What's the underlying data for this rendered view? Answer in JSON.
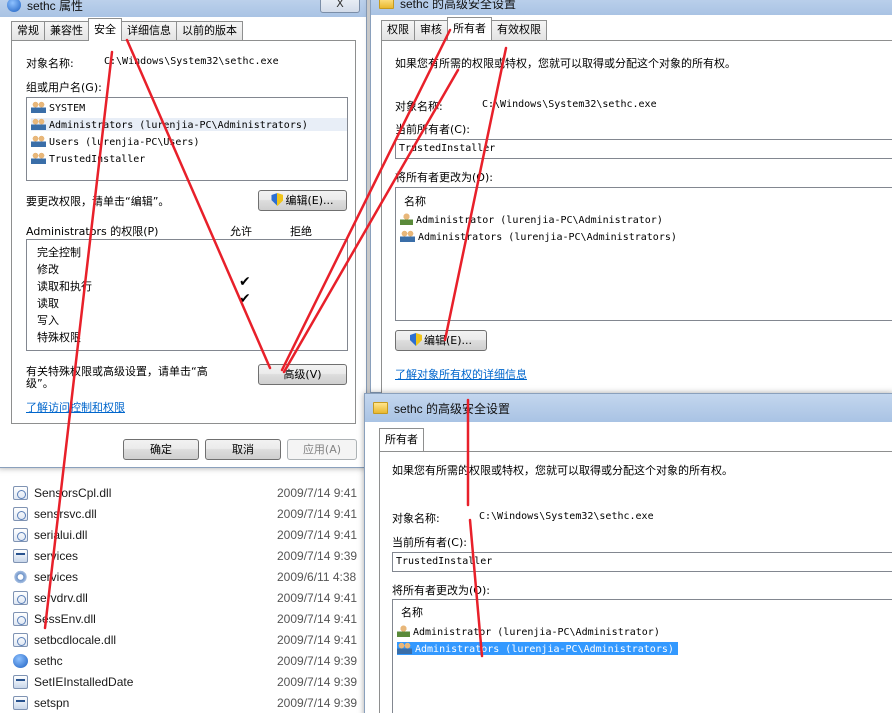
{
  "explorer": {
    "files": [
      {
        "name": "SensorsCpl.dll",
        "date": "2009/7/14 9:41",
        "icon": "dll"
      },
      {
        "name": "sensrsvc.dll",
        "date": "2009/7/14 9:41",
        "icon": "dll"
      },
      {
        "name": "serialui.dll",
        "date": "2009/7/14 9:41",
        "icon": "dll"
      },
      {
        "name": "services",
        "date": "2009/7/14 9:39",
        "icon": "app"
      },
      {
        "name": "services",
        "date": "2009/6/11 4:38",
        "icon": "gear"
      },
      {
        "name": "servdrv.dll",
        "date": "2009/7/14 9:41",
        "icon": "dll"
      },
      {
        "name": "SessEnv.dll",
        "date": "2009/7/14 9:41",
        "icon": "dll"
      },
      {
        "name": "setbcdlocale.dll",
        "date": "2009/7/14 9:41",
        "icon": "dll"
      },
      {
        "name": "sethc",
        "date": "2009/7/14 9:39",
        "icon": "blue"
      },
      {
        "name": "SetIEInstalledDate",
        "date": "2009/7/14 9:39",
        "icon": "app"
      },
      {
        "name": "setspn",
        "date": "2009/7/14 9:39",
        "icon": "app"
      }
    ]
  },
  "props": {
    "title": "sethc 属性",
    "close_glyph": "X",
    "tabs": [
      "常规",
      "兼容性",
      "安全",
      "详细信息",
      "以前的版本"
    ],
    "object_label": "对象名称:",
    "object_value": "C:\\Windows\\System32\\sethc.exe",
    "group_label": "组或用户名(G):",
    "users": [
      {
        "name": "SYSTEM",
        "icon": "group"
      },
      {
        "name": "Administrators (lurenjia-PC\\Administrators)",
        "icon": "group"
      },
      {
        "name": "Users (lurenjia-PC\\Users)",
        "icon": "group"
      },
      {
        "name": "TrustedInstaller",
        "icon": "group"
      }
    ],
    "change_text": "要更改权限，请单击“编辑”。",
    "edit_button": "编辑(E)...",
    "perm_label": "Administrators 的权限(P)",
    "allow_label": "允许",
    "deny_label": "拒绝",
    "permissions": [
      {
        "name": "完全控制",
        "allow": ""
      },
      {
        "name": "修改",
        "allow": ""
      },
      {
        "name": "读取和执行",
        "allow": "✔"
      },
      {
        "name": "读取",
        "allow": "✔"
      },
      {
        "name": "写入",
        "allow": ""
      },
      {
        "name": "特殊权限",
        "allow": ""
      }
    ],
    "advanced_text_1": "有关特殊权限或高级设置，请单击“高",
    "advanced_text_2": "级”。",
    "advanced_button": "高级(V)",
    "learn_link": "了解访问控制和权限",
    "ok_button": "确定",
    "cancel_button": "取消",
    "apply_button": "应用(A)"
  },
  "adv": {
    "title": "sethc 的高级安全设置",
    "tabs": [
      "权限",
      "审核",
      "所有者",
      "有效权限"
    ],
    "intro": "如果您有所需的权限或特权，您就可以取得或分配这个对象的所有权。",
    "object_label": "对象名称:",
    "object_value": "C:\\Windows\\System32\\sethc.exe",
    "owner_label": "当前所有者(C):",
    "owner_value": "TrustedInstaller",
    "change_owner_label": "将所有者更改为(O):",
    "name_header": "名称",
    "owners": [
      {
        "name": "Administrator (lurenjia-PC\\Administrator)",
        "icon": "user"
      },
      {
        "name": "Administrators (lurenjia-PC\\Administrators)",
        "icon": "group"
      }
    ],
    "edit_button": "编辑(E)...",
    "learn_link": "了解对象所有权的详细信息"
  },
  "adv2": {
    "title": "sethc 的高级安全设置",
    "tab": "所有者",
    "intro": "如果您有所需的权限或特权，您就可以取得或分配这个对象的所有权。",
    "object_label": "对象名称:",
    "object_value": "C:\\Windows\\System32\\sethc.exe",
    "owner_label": "当前所有者(C):",
    "owner_value": "TrustedInstaller",
    "change_owner_label": "将所有者更改为(O):",
    "name_header": "名称",
    "owners": [
      {
        "name": "Administrator (lurenjia-PC\\Administrator)",
        "icon": "user",
        "selected": false
      },
      {
        "name": "Administrators (lurenjia-PC\\Administrators)",
        "icon": "group",
        "selected": true
      }
    ]
  },
  "colors": {
    "annotation": "#e8202a",
    "link": "#0066cc",
    "selection": "#3399ff"
  }
}
